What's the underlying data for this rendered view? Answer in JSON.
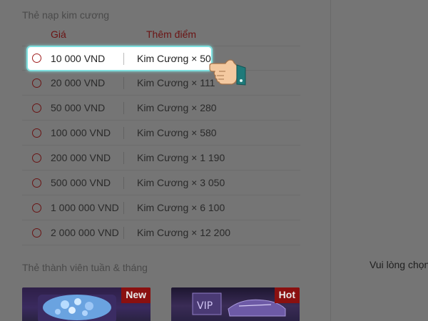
{
  "sections": {
    "diamond_cards_title": "Thẻ nạp kim cương",
    "membership_title": "Thẻ thành viên tuần & tháng"
  },
  "table_header": {
    "price": "Giá",
    "points": "Thêm điểm"
  },
  "rows": [
    {
      "price": "10 000 VND",
      "points": "Kim Cương × 50",
      "selected": true
    },
    {
      "price": "20 000 VND",
      "points": "Kim Cương × 111"
    },
    {
      "price": "50 000 VND",
      "points": "Kim Cương × 280"
    },
    {
      "price": "100 000 VND",
      "points": "Kim Cương × 580"
    },
    {
      "price": "200 000 VND",
      "points": "Kim Cương × 1 190"
    },
    {
      "price": "500 000 VND",
      "points": "Kim Cương × 3 050"
    },
    {
      "price": "1 000 000 VND",
      "points": "Kim Cương × 6 100"
    },
    {
      "price": "2 000 000 VND",
      "points": "Kim Cương × 12 200"
    }
  ],
  "right_panel": {
    "prompt": "Vui lòng chọn"
  },
  "cards": [
    {
      "badge": "New",
      "icon": "diamond-chest-icon"
    },
    {
      "badge": "Hot",
      "icon": "vip-sneaker-icon"
    }
  ],
  "colors": {
    "overlay_gray": "#757575",
    "accent_red": "#8a1010",
    "highlight_border": "#7fe0df"
  }
}
